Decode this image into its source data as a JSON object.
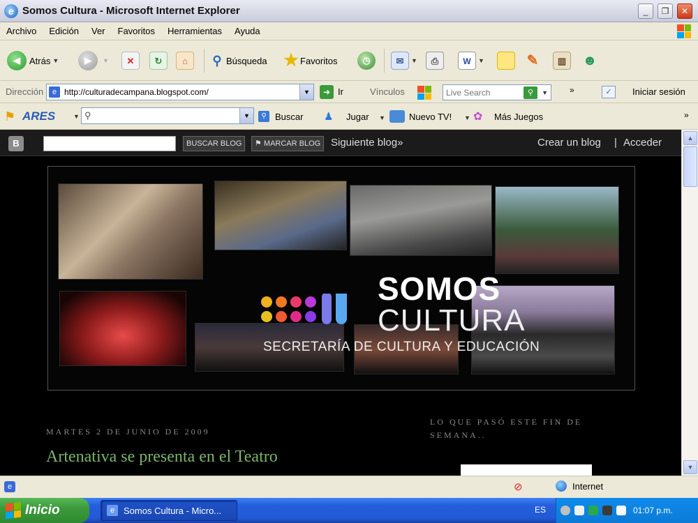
{
  "window": {
    "title": "Somos Cultura - Microsoft Internet Explorer"
  },
  "menu": [
    "Archivo",
    "Edición",
    "Ver",
    "Favoritos",
    "Herramientas",
    "Ayuda"
  ],
  "toolbar": {
    "back": "Atrás",
    "search": "Búsqueda",
    "favorites": "Favoritos"
  },
  "address": {
    "label": "Dirección",
    "url": "http://culturadecampana.blogspot.com/",
    "go": "Ir",
    "links": "Vínculos",
    "live_search_placeholder": "Live Search",
    "signin": "Iniciar sesión"
  },
  "ares": {
    "brand": "ARES",
    "search_btn": "Buscar",
    "play": "Jugar",
    "new_tv": "Nuevo TV!",
    "more_games": "Más Juegos"
  },
  "blogger": {
    "search_btn": "BUSCAR BLOG",
    "mark_btn": "MARCAR BLOG",
    "next": "Siguiente blog»",
    "create": "Crear un blog",
    "divider": "|",
    "login": "Acceder"
  },
  "banner": {
    "title_line1": "SOMOS",
    "title_line2": "CULTURA",
    "subtitle": "SECRETARÍA DE CULTURA Y EDUCACIÓN"
  },
  "post": {
    "date": "MARTES 2 DE JUNIO DE 2009",
    "title": "Artenativa se presenta en el Teatro"
  },
  "sidebar": {
    "heading": "LO QUE PASÓ ESTE FIN DE SEMANA.."
  },
  "status": {
    "zone": "Internet"
  },
  "taskbar": {
    "start": "Inicio",
    "task": "Somos Cultura - Micro...",
    "lang": "ES",
    "time": "01:07 p.m."
  },
  "colors": {
    "post_title": "#7ab56a",
    "taskbar": "#245edb",
    "start": "#3c9a3c"
  }
}
